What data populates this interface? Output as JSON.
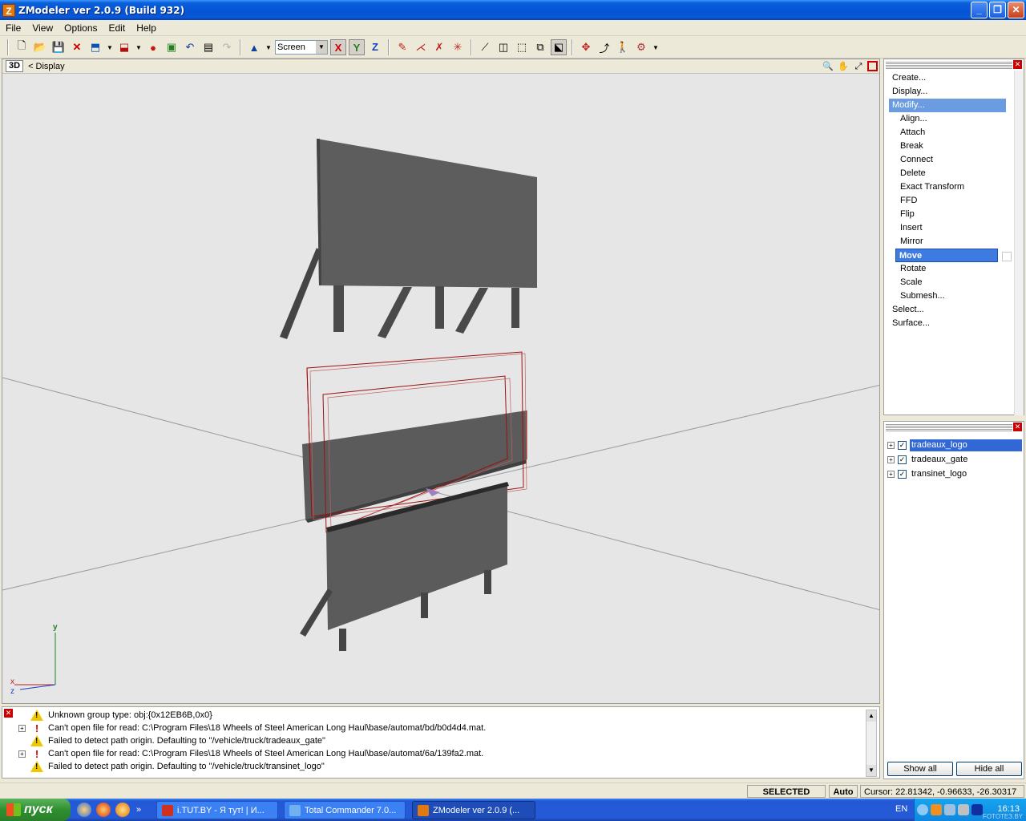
{
  "window": {
    "title": "ZModeler ver 2.0.9 (Build 932)",
    "app_icon_letter": "Z",
    "controls": {
      "minimize": "_",
      "maximize": "❐",
      "close": "✕"
    }
  },
  "menu": [
    "File",
    "View",
    "Options",
    "Edit",
    "Help"
  ],
  "toolbar": {
    "coord_system": "Screen",
    "axes": [
      "X",
      "Y",
      "Z"
    ]
  },
  "viewport": {
    "badge": "3D",
    "label": "< Display",
    "axis_labels": {
      "y": "y",
      "x": "x",
      "z": "z"
    }
  },
  "command_panel": {
    "items": [
      {
        "label": "Create...",
        "level": 0
      },
      {
        "label": "Display...",
        "level": 0
      },
      {
        "label": "Modify...",
        "level": 0,
        "state": "expanded"
      },
      {
        "label": "Align...",
        "level": 1
      },
      {
        "label": "Attach",
        "level": 1,
        "checkbox": true
      },
      {
        "label": "Break",
        "level": 1
      },
      {
        "label": "Connect",
        "level": 1
      },
      {
        "label": "Delete",
        "level": 1,
        "checkbox": true
      },
      {
        "label": "Exact Transform",
        "level": 1
      },
      {
        "label": "FFD",
        "level": 1,
        "checkbox": true
      },
      {
        "label": "Flip",
        "level": 1
      },
      {
        "label": "Insert",
        "level": 1,
        "checkbox": true
      },
      {
        "label": "Mirror",
        "level": 1,
        "checkbox": true
      },
      {
        "label": "Move",
        "level": 1,
        "state": "selected",
        "checkbox": true
      },
      {
        "label": "Rotate",
        "level": 1,
        "checkbox": true
      },
      {
        "label": "Scale",
        "level": 1,
        "checkbox": true
      },
      {
        "label": "Submesh...",
        "level": 1
      },
      {
        "label": "Select...",
        "level": 0
      },
      {
        "label": "Surface...",
        "level": 0
      }
    ]
  },
  "objects": {
    "items": [
      {
        "name": "tradeaux_logo",
        "checked": true,
        "selected": true
      },
      {
        "name": "tradeaux_gate",
        "checked": true,
        "selected": false
      },
      {
        "name": "transinet_logo",
        "checked": true,
        "selected": false
      }
    ],
    "show_all": "Show all",
    "hide_all": "Hide all"
  },
  "log": [
    {
      "type": "warning",
      "expandable": false,
      "text": "Unknown group type: obj:{0x12EB6B,0x0}"
    },
    {
      "type": "error",
      "expandable": true,
      "text": "Can't open file for read: C:\\Program Files\\18 Wheels of Steel American Long Haul\\base/automat/bd/b0d4d4.mat."
    },
    {
      "type": "warning",
      "expandable": false,
      "text": "Failed to detect path origin. Defaulting to \"/vehicle/truck/tradeaux_gate\""
    },
    {
      "type": "error",
      "expandable": true,
      "text": "Can't open file for read: C:\\Program Files\\18 Wheels of Steel American Long Haul\\base/automat/6a/139fa2.mat."
    },
    {
      "type": "warning",
      "expandable": false,
      "text": "Failed to detect path origin. Defaulting to \"/vehicle/truck/transinet_logo\""
    }
  ],
  "status": {
    "mode": "SELECTED MODE",
    "auto": "Auto",
    "cursor": "Cursor: 22.81342, -0.96633, -26.30317"
  },
  "taskbar": {
    "start": "пуск",
    "tasks": [
      {
        "label": "i.TUT.BY - Я тут! | И...",
        "active": false
      },
      {
        "label": "Total Commander 7.0...",
        "active": false
      },
      {
        "label": "ZModeler ver 2.0.9 (...",
        "active": true
      }
    ],
    "lang": "EN",
    "clock": "16:13",
    "watermark": "FOTOTEЗ.BY"
  },
  "colors": {
    "selection_wire": "#a01010",
    "mesh": "#5a5a5a",
    "menu_highlight": "#3d7be0"
  }
}
